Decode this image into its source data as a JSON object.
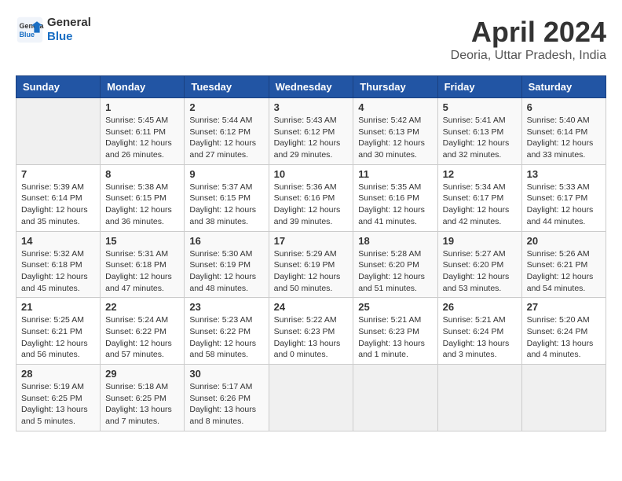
{
  "header": {
    "logo_line1": "General",
    "logo_line2": "Blue",
    "month_year": "April 2024",
    "location": "Deoria, Uttar Pradesh, India"
  },
  "weekdays": [
    "Sunday",
    "Monday",
    "Tuesday",
    "Wednesday",
    "Thursday",
    "Friday",
    "Saturday"
  ],
  "weeks": [
    [
      {
        "day": "",
        "info": ""
      },
      {
        "day": "1",
        "info": "Sunrise: 5:45 AM\nSunset: 6:11 PM\nDaylight: 12 hours\nand 26 minutes."
      },
      {
        "day": "2",
        "info": "Sunrise: 5:44 AM\nSunset: 6:12 PM\nDaylight: 12 hours\nand 27 minutes."
      },
      {
        "day": "3",
        "info": "Sunrise: 5:43 AM\nSunset: 6:12 PM\nDaylight: 12 hours\nand 29 minutes."
      },
      {
        "day": "4",
        "info": "Sunrise: 5:42 AM\nSunset: 6:13 PM\nDaylight: 12 hours\nand 30 minutes."
      },
      {
        "day": "5",
        "info": "Sunrise: 5:41 AM\nSunset: 6:13 PM\nDaylight: 12 hours\nand 32 minutes."
      },
      {
        "day": "6",
        "info": "Sunrise: 5:40 AM\nSunset: 6:14 PM\nDaylight: 12 hours\nand 33 minutes."
      }
    ],
    [
      {
        "day": "7",
        "info": "Sunrise: 5:39 AM\nSunset: 6:14 PM\nDaylight: 12 hours\nand 35 minutes."
      },
      {
        "day": "8",
        "info": "Sunrise: 5:38 AM\nSunset: 6:15 PM\nDaylight: 12 hours\nand 36 minutes."
      },
      {
        "day": "9",
        "info": "Sunrise: 5:37 AM\nSunset: 6:15 PM\nDaylight: 12 hours\nand 38 minutes."
      },
      {
        "day": "10",
        "info": "Sunrise: 5:36 AM\nSunset: 6:16 PM\nDaylight: 12 hours\nand 39 minutes."
      },
      {
        "day": "11",
        "info": "Sunrise: 5:35 AM\nSunset: 6:16 PM\nDaylight: 12 hours\nand 41 minutes."
      },
      {
        "day": "12",
        "info": "Sunrise: 5:34 AM\nSunset: 6:17 PM\nDaylight: 12 hours\nand 42 minutes."
      },
      {
        "day": "13",
        "info": "Sunrise: 5:33 AM\nSunset: 6:17 PM\nDaylight: 12 hours\nand 44 minutes."
      }
    ],
    [
      {
        "day": "14",
        "info": "Sunrise: 5:32 AM\nSunset: 6:18 PM\nDaylight: 12 hours\nand 45 minutes."
      },
      {
        "day": "15",
        "info": "Sunrise: 5:31 AM\nSunset: 6:18 PM\nDaylight: 12 hours\nand 47 minutes."
      },
      {
        "day": "16",
        "info": "Sunrise: 5:30 AM\nSunset: 6:19 PM\nDaylight: 12 hours\nand 48 minutes."
      },
      {
        "day": "17",
        "info": "Sunrise: 5:29 AM\nSunset: 6:19 PM\nDaylight: 12 hours\nand 50 minutes."
      },
      {
        "day": "18",
        "info": "Sunrise: 5:28 AM\nSunset: 6:20 PM\nDaylight: 12 hours\nand 51 minutes."
      },
      {
        "day": "19",
        "info": "Sunrise: 5:27 AM\nSunset: 6:20 PM\nDaylight: 12 hours\nand 53 minutes."
      },
      {
        "day": "20",
        "info": "Sunrise: 5:26 AM\nSunset: 6:21 PM\nDaylight: 12 hours\nand 54 minutes."
      }
    ],
    [
      {
        "day": "21",
        "info": "Sunrise: 5:25 AM\nSunset: 6:21 PM\nDaylight: 12 hours\nand 56 minutes."
      },
      {
        "day": "22",
        "info": "Sunrise: 5:24 AM\nSunset: 6:22 PM\nDaylight: 12 hours\nand 57 minutes."
      },
      {
        "day": "23",
        "info": "Sunrise: 5:23 AM\nSunset: 6:22 PM\nDaylight: 12 hours\nand 58 minutes."
      },
      {
        "day": "24",
        "info": "Sunrise: 5:22 AM\nSunset: 6:23 PM\nDaylight: 13 hours\nand 0 minutes."
      },
      {
        "day": "25",
        "info": "Sunrise: 5:21 AM\nSunset: 6:23 PM\nDaylight: 13 hours\nand 1 minute."
      },
      {
        "day": "26",
        "info": "Sunrise: 5:21 AM\nSunset: 6:24 PM\nDaylight: 13 hours\nand 3 minutes."
      },
      {
        "day": "27",
        "info": "Sunrise: 5:20 AM\nSunset: 6:24 PM\nDaylight: 13 hours\nand 4 minutes."
      }
    ],
    [
      {
        "day": "28",
        "info": "Sunrise: 5:19 AM\nSunset: 6:25 PM\nDaylight: 13 hours\nand 5 minutes."
      },
      {
        "day": "29",
        "info": "Sunrise: 5:18 AM\nSunset: 6:25 PM\nDaylight: 13 hours\nand 7 minutes."
      },
      {
        "day": "30",
        "info": "Sunrise: 5:17 AM\nSunset: 6:26 PM\nDaylight: 13 hours\nand 8 minutes."
      },
      {
        "day": "",
        "info": ""
      },
      {
        "day": "",
        "info": ""
      },
      {
        "day": "",
        "info": ""
      },
      {
        "day": "",
        "info": ""
      }
    ]
  ]
}
